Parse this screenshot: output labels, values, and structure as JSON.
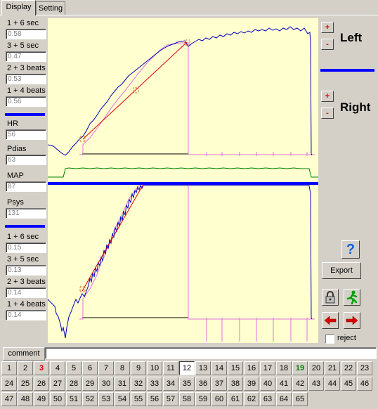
{
  "tabs": [
    "Display",
    "Setting"
  ],
  "left_top": [
    {
      "label": "1 + 6 sec",
      "value": "0.58"
    },
    {
      "label": "3 + 5 sec",
      "value": "0.47"
    },
    {
      "label": "2 + 3 beats",
      "value": "0.53"
    },
    {
      "label": "1 + 4 beats",
      "value": "0.56"
    }
  ],
  "vitals": [
    {
      "label": "HR",
      "value": "56"
    },
    {
      "label": "Pdias",
      "value": "63"
    },
    {
      "label": "MAP",
      "value": "87"
    },
    {
      "label": "Psys",
      "value": "131"
    }
  ],
  "left_bottom": [
    {
      "label": "1 + 6 sec",
      "value": "0.15"
    },
    {
      "label": "3 + 5 sec",
      "value": "0.13"
    },
    {
      "label": "2 + 3 beats",
      "value": "0.14"
    },
    {
      "label": "1 + 4 beats",
      "value": "0.14"
    }
  ],
  "right_panel": {
    "left_title": "Left",
    "right_title": "Right",
    "plus": "+",
    "minus": "-",
    "help_glyph": "?",
    "export_label": "Export",
    "reject_label": "reject",
    "reject_checked": false,
    "lock_icon": "lock-icon",
    "run_icon": "running-man-icon",
    "prev_icon": "red-left-arrow-icon",
    "next_icon": "red-right-arrow-icon"
  },
  "comment": {
    "label": "comment",
    "value": ""
  },
  "pages": [
    "1",
    "2",
    "3",
    "4",
    "5",
    "6",
    "7",
    "8",
    "9",
    "10",
    "11",
    "12",
    "13",
    "14",
    "15",
    "16",
    "17",
    "18",
    "19",
    "20",
    "21",
    "22",
    "23",
    "24",
    "25",
    "26",
    "27",
    "28",
    "29",
    "30",
    "31",
    "32",
    "33",
    "34",
    "35",
    "36",
    "37",
    "38",
    "39",
    "40",
    "41",
    "42",
    "43",
    "44",
    "45",
    "46",
    "47",
    "48",
    "49",
    "50",
    "51",
    "52",
    "53",
    "54",
    "55",
    "56",
    "57",
    "58",
    "59",
    "60",
    "61",
    "62",
    "63",
    "64",
    "65"
  ],
  "selected_page": "12",
  "red_page": "3",
  "green_page": "19",
  "colors": {
    "plot_bg": "#ffffd0",
    "trace": "#0000c0",
    "fit": "#e00000",
    "marker": "#e070e0",
    "hr": "#008000",
    "divider": "#0000ff"
  }
}
